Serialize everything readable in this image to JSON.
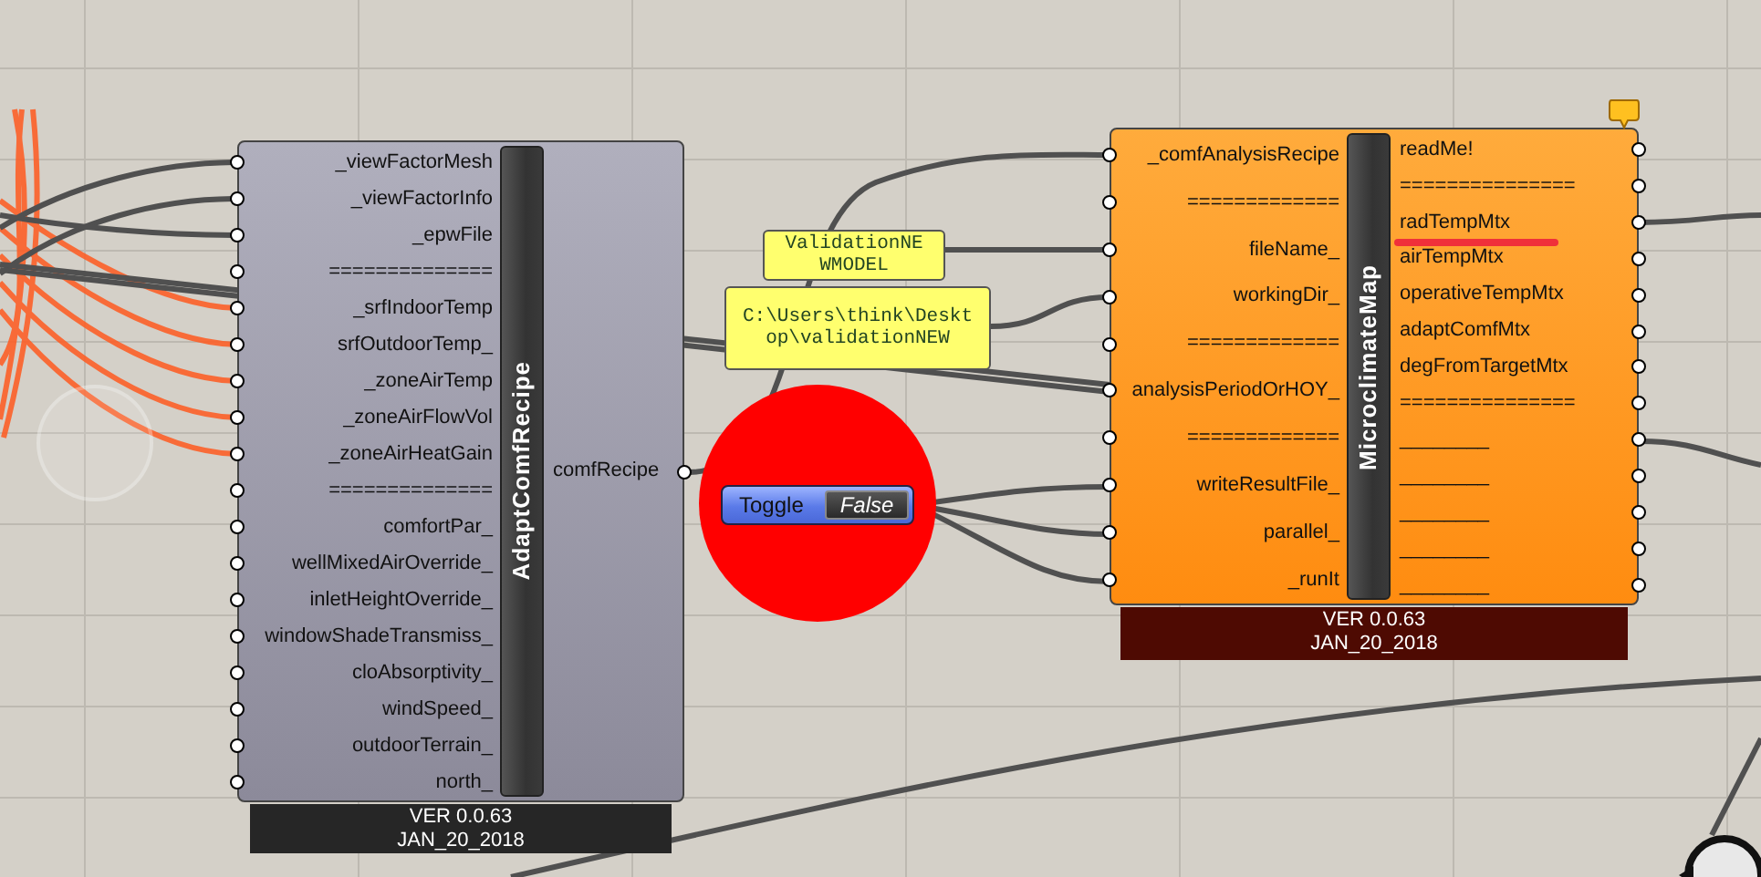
{
  "components": [
    {
      "title": "AdaptComfRecipe",
      "kind": "normal",
      "has_comment": false,
      "inputs": [
        {
          "label": "_viewFactorMesh"
        },
        {
          "label": "_viewFactorInfo"
        },
        {
          "label": "_epwFile"
        },
        {
          "label": "=============="
        },
        {
          "label": "_srfIndoorTemp"
        },
        {
          "label": "srfOutdoorTemp_"
        },
        {
          "label": "_zoneAirTemp"
        },
        {
          "label": "_zoneAirFlowVol"
        },
        {
          "label": "_zoneAirHeatGain"
        },
        {
          "label": "=============="
        },
        {
          "label": "comfortPar_"
        },
        {
          "label": "wellMixedAirOverride_"
        },
        {
          "label": "inletHeightOverride_"
        },
        {
          "label": "windowShadeTransmiss_"
        },
        {
          "label": "cloAbsorptivity_"
        },
        {
          "label": "windSpeed_"
        },
        {
          "label": "outdoorTerrain_"
        },
        {
          "label": "north_"
        }
      ],
      "outputs": [
        {
          "label": "comfRecipe",
          "underlined": false
        }
      ],
      "version": "VER 0.0.63",
      "date": "JAN_20_2018"
    },
    {
      "title": "MicroclimateMap",
      "kind": "warning",
      "has_comment": true,
      "inputs": [
        {
          "label": "_comfAnalysisRecipe"
        },
        {
          "label": "============="
        },
        {
          "label": "fileName_"
        },
        {
          "label": "workingDir_"
        },
        {
          "label": "============="
        },
        {
          "label": "analysisPeriodOrHOY_"
        },
        {
          "label": "============="
        },
        {
          "label": "writeResultFile_"
        },
        {
          "label": "parallel_"
        },
        {
          "label": "_runIt"
        }
      ],
      "outputs": [
        {
          "label": "readMe!",
          "underlined": false
        },
        {
          "label": "===============",
          "underlined": false
        },
        {
          "label": "radTempMtx",
          "underlined": true
        },
        {
          "label": "airTempMtx",
          "underlined": false
        },
        {
          "label": "operativeTempMtx",
          "underlined": false
        },
        {
          "label": "adaptComfMtx",
          "underlined": false
        },
        {
          "label": "degFromTargetMtx",
          "underlined": false
        },
        {
          "label": "===============",
          "underlined": false
        },
        {
          "label": "________",
          "underlined": false
        },
        {
          "label": "________",
          "underlined": false
        },
        {
          "label": "________",
          "underlined": false
        },
        {
          "label": "________",
          "underlined": false
        },
        {
          "label": "________",
          "underlined": false
        }
      ],
      "version": "VER 0.0.63",
      "date": "JAN_20_2018"
    }
  ],
  "panels": [
    {
      "lines": [
        "ValidationNE",
        "WMODEL"
      ]
    },
    {
      "lines": [
        "C:\\Users\\think\\Deskt",
        "op\\validationNEW"
      ]
    }
  ],
  "toggle": {
    "label": "Toggle",
    "value": "False"
  }
}
